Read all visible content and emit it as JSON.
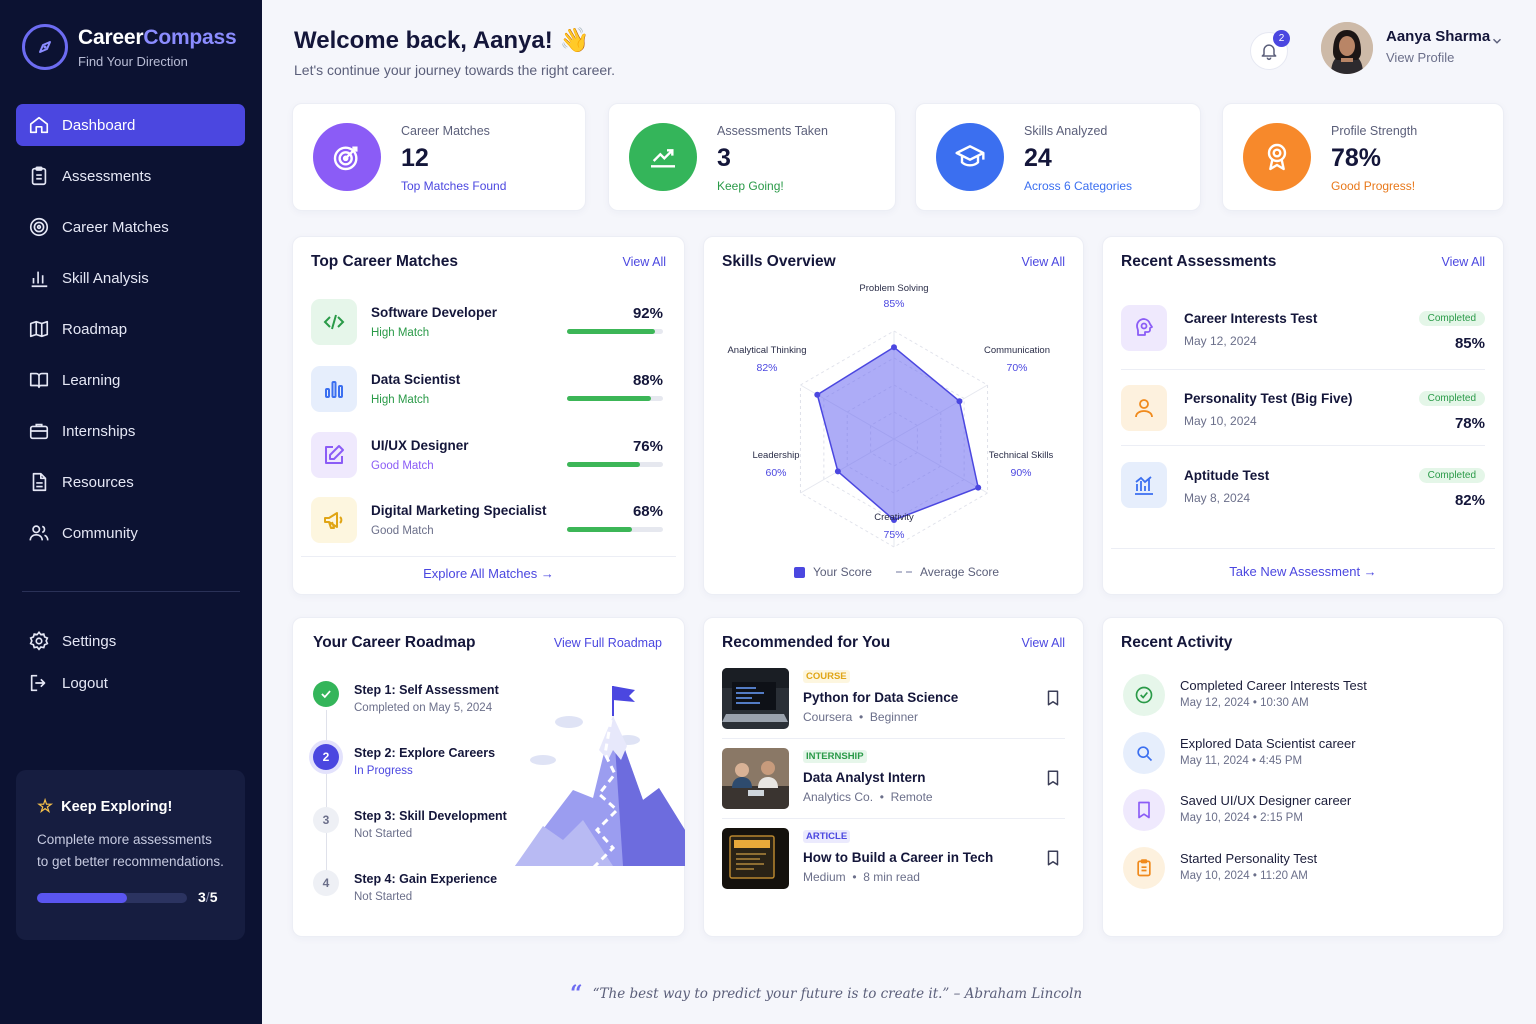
{
  "brand": {
    "name_part1": "Career",
    "name_part2": "Compass",
    "tagline": "Find Your Direction"
  },
  "nav": [
    {
      "label": "Dashboard",
      "icon": "home-icon"
    },
    {
      "label": "Assessments",
      "icon": "clipboard-icon"
    },
    {
      "label": "Career Matches",
      "icon": "target-icon"
    },
    {
      "label": "Skill Analysis",
      "icon": "bar-chart-icon"
    },
    {
      "label": "Roadmap",
      "icon": "map-icon"
    },
    {
      "label": "Learning",
      "icon": "book-icon"
    },
    {
      "label": "Internships",
      "icon": "briefcase-icon"
    },
    {
      "label": "Resources",
      "icon": "document-icon"
    },
    {
      "label": "Community",
      "icon": "users-icon"
    }
  ],
  "nav_secondary": [
    {
      "label": "Settings",
      "icon": "gear-icon"
    },
    {
      "label": "Logout",
      "icon": "logout-icon"
    }
  ],
  "explore": {
    "title": "Keep Exploring!",
    "text": "Complete more assessments to get better recommendations.",
    "done": "3",
    "sep": "/",
    "total": "5",
    "progress": 0.6
  },
  "header": {
    "greeting": "Welcome back, Aanya! 👋",
    "subtitle": "Let's continue your journey towards the right career.",
    "notifications": "2"
  },
  "user": {
    "name": "Aanya Sharma",
    "link": "View Profile"
  },
  "stats": [
    {
      "label": "Career Matches",
      "value": "12",
      "sub": "Top Matches Found",
      "color": "#8b5cf6",
      "sub_color": "#4b47e0",
      "icon": "target-icon"
    },
    {
      "label": "Assessments Taken",
      "value": "3",
      "sub": "Keep Going!",
      "color": "#34b55a",
      "sub_color": "#2a9a48",
      "icon": "trend-up-icon"
    },
    {
      "label": "Skills Analyzed",
      "value": "24",
      "sub": "Across 6 Categories",
      "color": "#3b6ff0",
      "sub_color": "#3b6ff0",
      "icon": "graduation-cap-icon"
    },
    {
      "label": "Profile Strength",
      "value": "78%",
      "sub": "Good Progress!",
      "color": "#f7892b",
      "sub_color": "#e8781a",
      "icon": "award-icon"
    }
  ],
  "top_matches": {
    "title": "Top Career Matches",
    "link": "View All",
    "footer": "Explore All Matches →",
    "items": [
      {
        "name": "Software Developer",
        "tag": "High Match",
        "pct": "92%",
        "value": 0.92,
        "tag_color": "#2a9a48",
        "icon": "code-icon",
        "bg": "#e6f6ea",
        "fg": "#2a9a48"
      },
      {
        "name": "Data Scientist",
        "tag": "High Match",
        "pct": "88%",
        "value": 0.88,
        "tag_color": "#2a9a48",
        "icon": "bar-chart-icon",
        "bg": "#e6eefc",
        "fg": "#3b6ff0"
      },
      {
        "name": "UI/UX Designer",
        "tag": "Good Match",
        "pct": "76%",
        "value": 0.76,
        "tag_color": "#8b5cf6",
        "icon": "edit-icon",
        "bg": "#efe9fd",
        "fg": "#8b5cf6"
      },
      {
        "name": "Digital Marketing Specialist",
        "tag": "Good Match",
        "pct": "68%",
        "value": 0.68,
        "tag_color": "#6b6f8a",
        "icon": "megaphone-icon",
        "bg": "#fdf6df",
        "fg": "#e0a516"
      }
    ]
  },
  "skills": {
    "title": "Skills Overview",
    "link": "View All",
    "legend_yours": "Your Score",
    "legend_avg": "Average Score",
    "chart_data": {
      "type": "radar",
      "categories": [
        "Problem Solving",
        "Communication",
        "Technical Skills",
        "Creativity",
        "Leadership",
        "Analytical Thinking"
      ],
      "series": [
        {
          "name": "Your Score",
          "values": [
            85,
            70,
            90,
            75,
            60,
            82
          ]
        }
      ],
      "value_labels": [
        "85%",
        "70%",
        "90%",
        "75%",
        "60%",
        "82%"
      ],
      "range": [
        0,
        100
      ]
    }
  },
  "recent_assessments": {
    "title": "Recent Assessments",
    "link": "View All",
    "footer": "Take New Assessment →",
    "items": [
      {
        "name": "Career Interests Test",
        "date": "May 12, 2024",
        "status": "Completed",
        "pct": "85%",
        "icon": "brain-icon",
        "bg": "#efe9fd",
        "fg": "#8b5cf6"
      },
      {
        "name": "Personality Test (Big Five)",
        "date": "May 10, 2024",
        "status": "Completed",
        "pct": "78%",
        "icon": "person-icon",
        "bg": "#fdf1de",
        "fg": "#f08a1c"
      },
      {
        "name": "Aptitude Test",
        "date": "May 8, 2024",
        "status": "Completed",
        "pct": "82%",
        "icon": "chart-icon",
        "bg": "#e6eefc",
        "fg": "#3b6ff0"
      }
    ]
  },
  "roadmap": {
    "title": "Your Career Roadmap",
    "link": "View Full Roadmap",
    "steps": [
      {
        "title": "Step 1: Self Assessment",
        "sub": "Completed on May 5, 2024",
        "state": "done",
        "num": ""
      },
      {
        "title": "Step 2: Explore Careers",
        "sub": "In Progress",
        "state": "active",
        "num": "2"
      },
      {
        "title": "Step 3: Skill Development",
        "sub": "Not Started",
        "state": "todo",
        "num": "3"
      },
      {
        "title": "Step 4: Gain Experience",
        "sub": "Not Started",
        "state": "todo",
        "num": "4"
      }
    ]
  },
  "recommended": {
    "title": "Recommended for You",
    "link": "View All",
    "items": [
      {
        "tag": "COURSE",
        "title": "Python for Data Science",
        "source": "Coursera",
        "detail": "Beginner",
        "tag_color": "#e0a516",
        "tag_bg": "#fdf6df",
        "thumb": "laptop-thumbnail"
      },
      {
        "tag": "INTERNSHIP",
        "title": "Data Analyst Intern",
        "source": "Analytics Co.",
        "detail": "Remote",
        "tag_color": "#2a9a48",
        "tag_bg": "#e6f6ea",
        "thumb": "team-thumbnail"
      },
      {
        "tag": "ARTICLE",
        "title": "How to Build a Career in Tech",
        "source": "Medium",
        "detail": "8 min read",
        "tag_color": "#4b47e0",
        "tag_bg": "#ebeafd",
        "thumb": "board-thumbnail"
      }
    ]
  },
  "activity": {
    "title": "Recent Activity",
    "items": [
      {
        "title": "Completed Career Interests Test",
        "time": "May 12, 2024 • 10:30 AM",
        "icon": "check-circle-icon",
        "bg": "#e6f6ea",
        "fg": "#2a9a48"
      },
      {
        "title": "Explored Data Scientist career",
        "time": "May 11, 2024 • 4:45 PM",
        "icon": "search-icon",
        "bg": "#e6eefc",
        "fg": "#3b6ff0"
      },
      {
        "title": "Saved UI/UX Designer career",
        "time": "May 10, 2024 • 2:15 PM",
        "icon": "bookmark-icon",
        "bg": "#efe9fd",
        "fg": "#8b5cf6"
      },
      {
        "title": "Started Personality Test",
        "time": "May 10, 2024 • 11:20 AM",
        "icon": "clipboard-icon",
        "bg": "#fdf1de",
        "fg": "#f08a1c"
      }
    ]
  },
  "quote": "“The best way to predict your future is to create it.” – Abraham Lincoln"
}
